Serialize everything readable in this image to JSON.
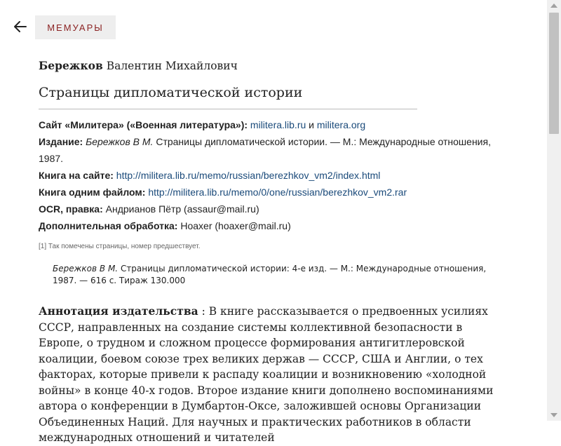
{
  "header": {
    "tag_label": "Мемуары"
  },
  "book": {
    "author_last": "Бережков",
    "author_rest": " Валентин Михайлович",
    "title": "Страницы дипломатической истории"
  },
  "info": {
    "site_label": "Сайт «Милитера» («Военная литература»):",
    "site_link1": "militera.lib.ru",
    "site_and": " и ",
    "site_link2": "militera.org",
    "edition_label": "Издание:",
    "edition_author": "Бережков В М.",
    "edition_text": " Страницы дипломатической истории. — М.: Международные отношения, 1987.",
    "onsite_label": "Книга на сайте:",
    "onsite_link": "http://militera.lib.ru/memo/russian/berezhkov_vm2/index.html",
    "onefile_label": "Книга одним файлом:",
    "onefile_link": "http://militera.lib.ru/memo/0/one/russian/berezhkov_vm2.rar",
    "ocr_label": "OCR, правка:",
    "ocr_text": " Андрианов Пётр (assaur@mail.ru)",
    "extra_label": "Дополнительная обработка:",
    "extra_text": " Hoaxer (hoaxer@mail.ru)"
  },
  "note": "[1] Так помечены страницы, номер предшествует.",
  "biblio": {
    "author": "Бережков В М.",
    "title": " Страницы дипломатической истории:",
    "rest": " 4-е изд. — М.: Международные отношения, 1987. — 616 с. Тираж 130.000"
  },
  "annotation": {
    "label": "Аннотация издательства",
    "text": " : В книге рассказывается о предвоенных усилиях СССР, направленных на создание системы коллективной безопасности в Европе, о трудном и сложном процессе формирования антигитлеровской коалиции, боевом союзе трех великих держав — СССР, США и Англии, о тех факторах, которые привели к распаду коалиции и возникновению «холодной войны» в конце 40-х годов. Второе издание книги дополнено воспоминаниями автора о конференции в Думбартон-Оксе, заложившей основы Организации Объединенных Наций. Для научных и практических работников в области международных отношений и читателей"
  },
  "icons": {
    "back": "arrow-left-icon"
  },
  "colors": {
    "tag_text": "#8b2323",
    "link": "#1a4a7a",
    "tag_bg": "#eeeeee"
  }
}
